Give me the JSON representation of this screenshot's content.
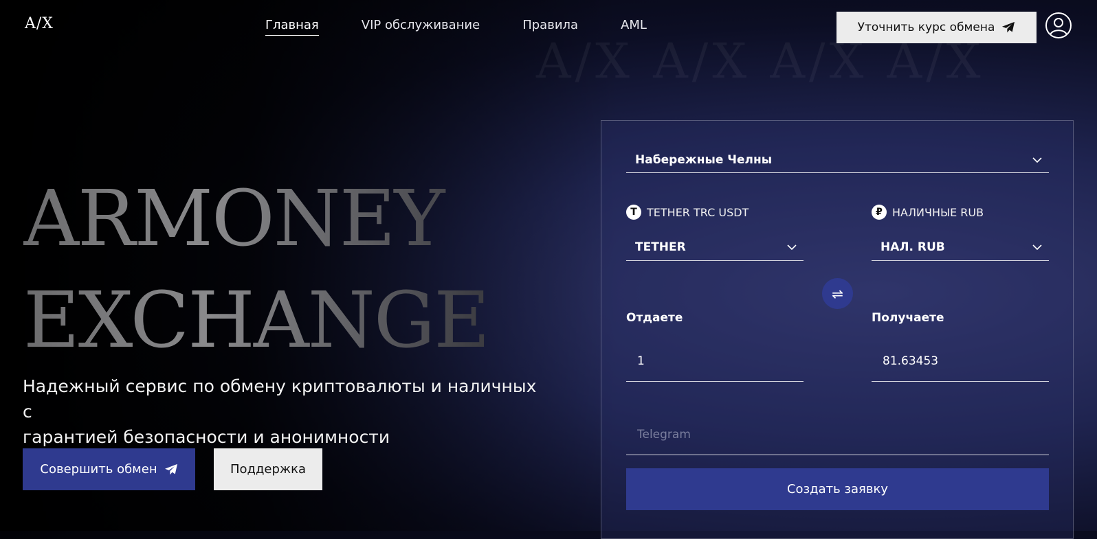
{
  "logo": "A/X",
  "watermark": "A/X A/X A/X A/X",
  "nav": [
    {
      "label": "Главная"
    },
    {
      "label": "VIP обслуживание"
    },
    {
      "label": "Правила"
    },
    {
      "label": "AML"
    }
  ],
  "header": {
    "rate_button": "Уточнить курс обмена"
  },
  "hero": {
    "title_line1": "ARMONEY",
    "title_line2": "EXCHANGE",
    "tagline_line1": "Надежный сервис по обмену криптовалюты и наличных с",
    "tagline_line2": "гарантией безопасности и анонимности",
    "primary_button": "Совершить обмен",
    "secondary_button": "Поддержка"
  },
  "form": {
    "city": "Набережные Челны",
    "give_currency_label": "TETHER TRC USDT",
    "give_currency_icon": "T",
    "give_currency_select": "TETHER",
    "get_currency_label": "НАЛИЧНЫЕ RUB",
    "get_currency_icon": "₽",
    "get_currency_select": "НАЛ. RUB",
    "give_label": "Отдаете",
    "give_value": "1",
    "get_label": "Получаете",
    "get_value": "81.63453",
    "telegram_placeholder": "Telegram",
    "submit": "Создать заявку"
  },
  "colors": {
    "accent": "#2f3a8f",
    "light_button": "#ececec"
  }
}
